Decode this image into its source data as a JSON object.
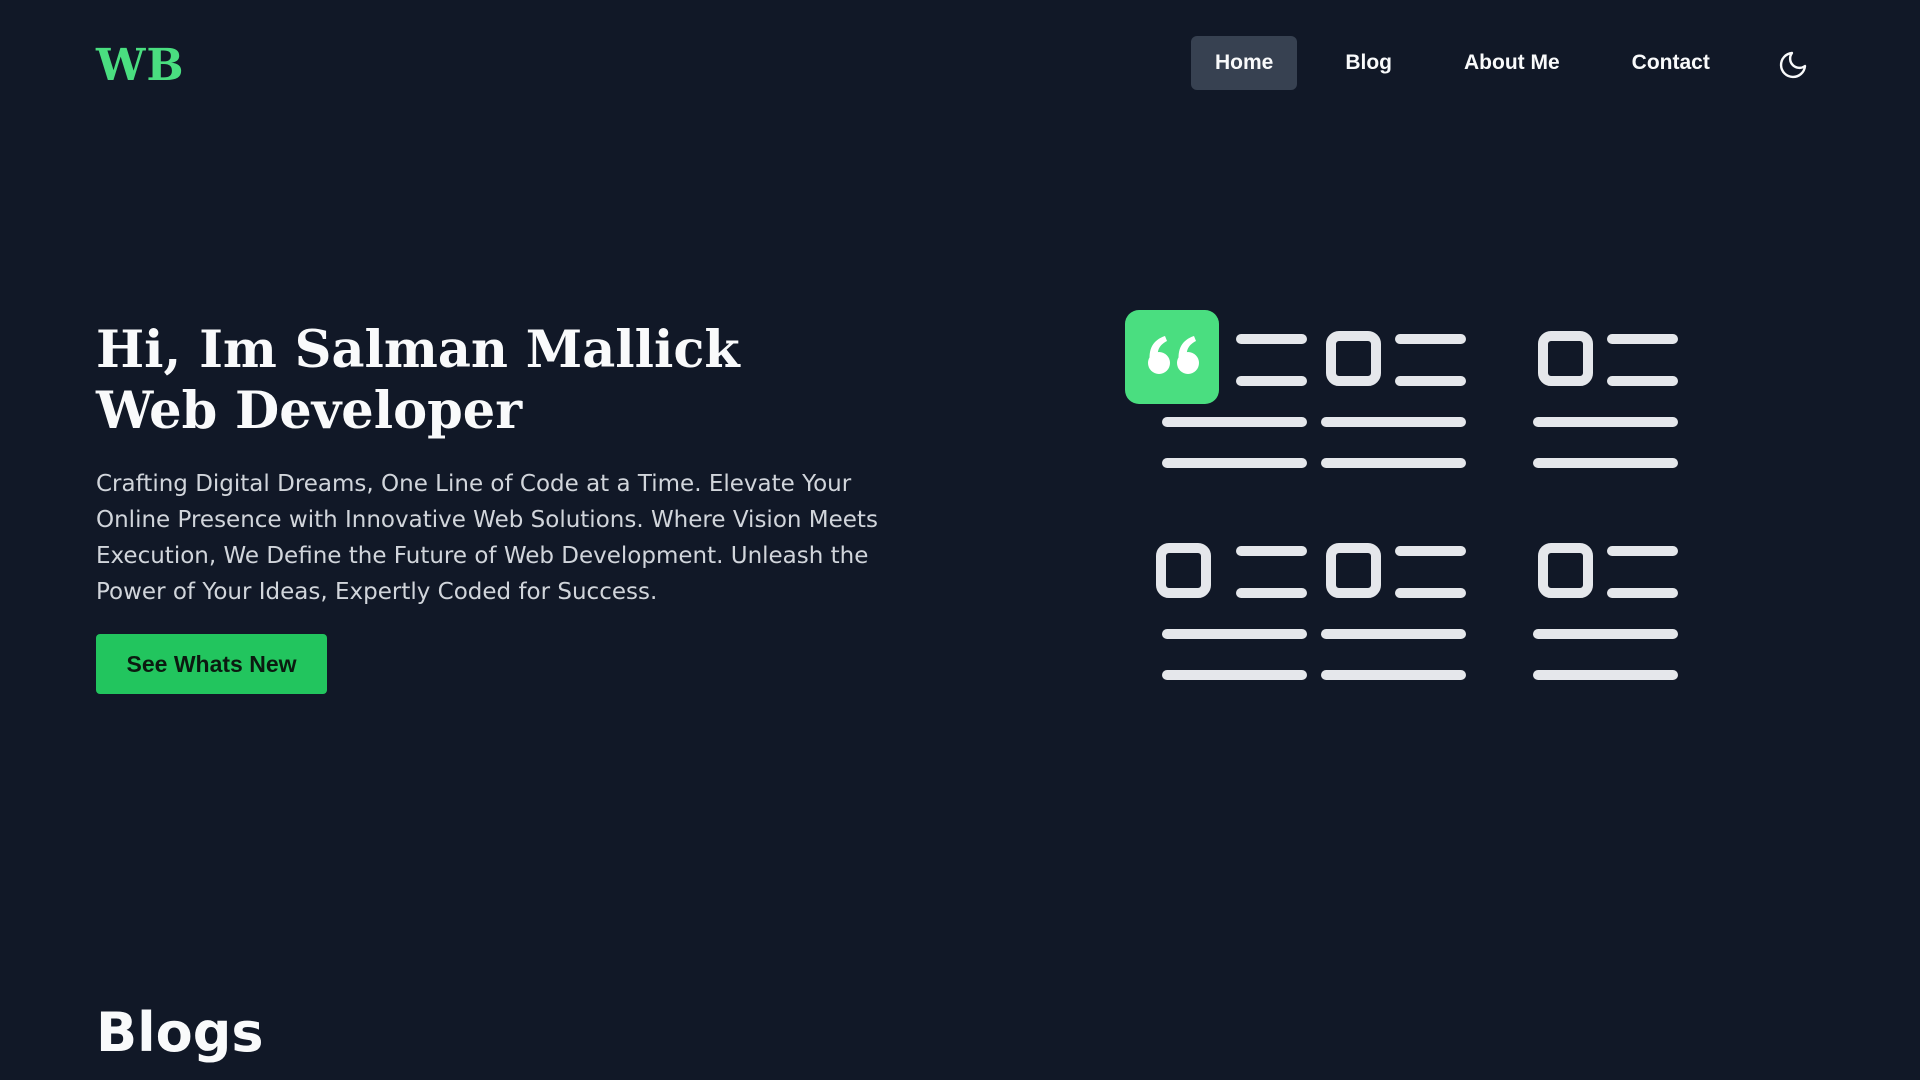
{
  "header": {
    "logo": "WB",
    "nav": [
      {
        "label": "Home",
        "active": true
      },
      {
        "label": "Blog",
        "active": false
      },
      {
        "label": "About Me",
        "active": false
      },
      {
        "label": "Contact",
        "active": false
      }
    ],
    "theme_toggle_icon": "moon-icon"
  },
  "hero": {
    "title_line1": "Hi, Im Salman Mallick",
    "title_line2": "Web Developer",
    "description": "Crafting Digital Dreams, One Line of Code at a Time. Elevate Your Online Presence with Innovative Web Solutions. Where Vision Meets Execution, We Define the Future of Web Development. Unleash the Power of Your Ideas, Expertly Coded for Success.",
    "cta_label": "See Whats New",
    "illustration_icons": [
      "quote-icon",
      "list-item-icon"
    ]
  },
  "blogs": {
    "heading": "Blogs"
  },
  "colors": {
    "background": "#111827",
    "accent": "#4ade80",
    "button": "#22c55e",
    "nav_active": "#374151",
    "text": "#f9fafb",
    "muted_text": "#d1d5db",
    "illustration_lines": "#e5e7eb"
  }
}
